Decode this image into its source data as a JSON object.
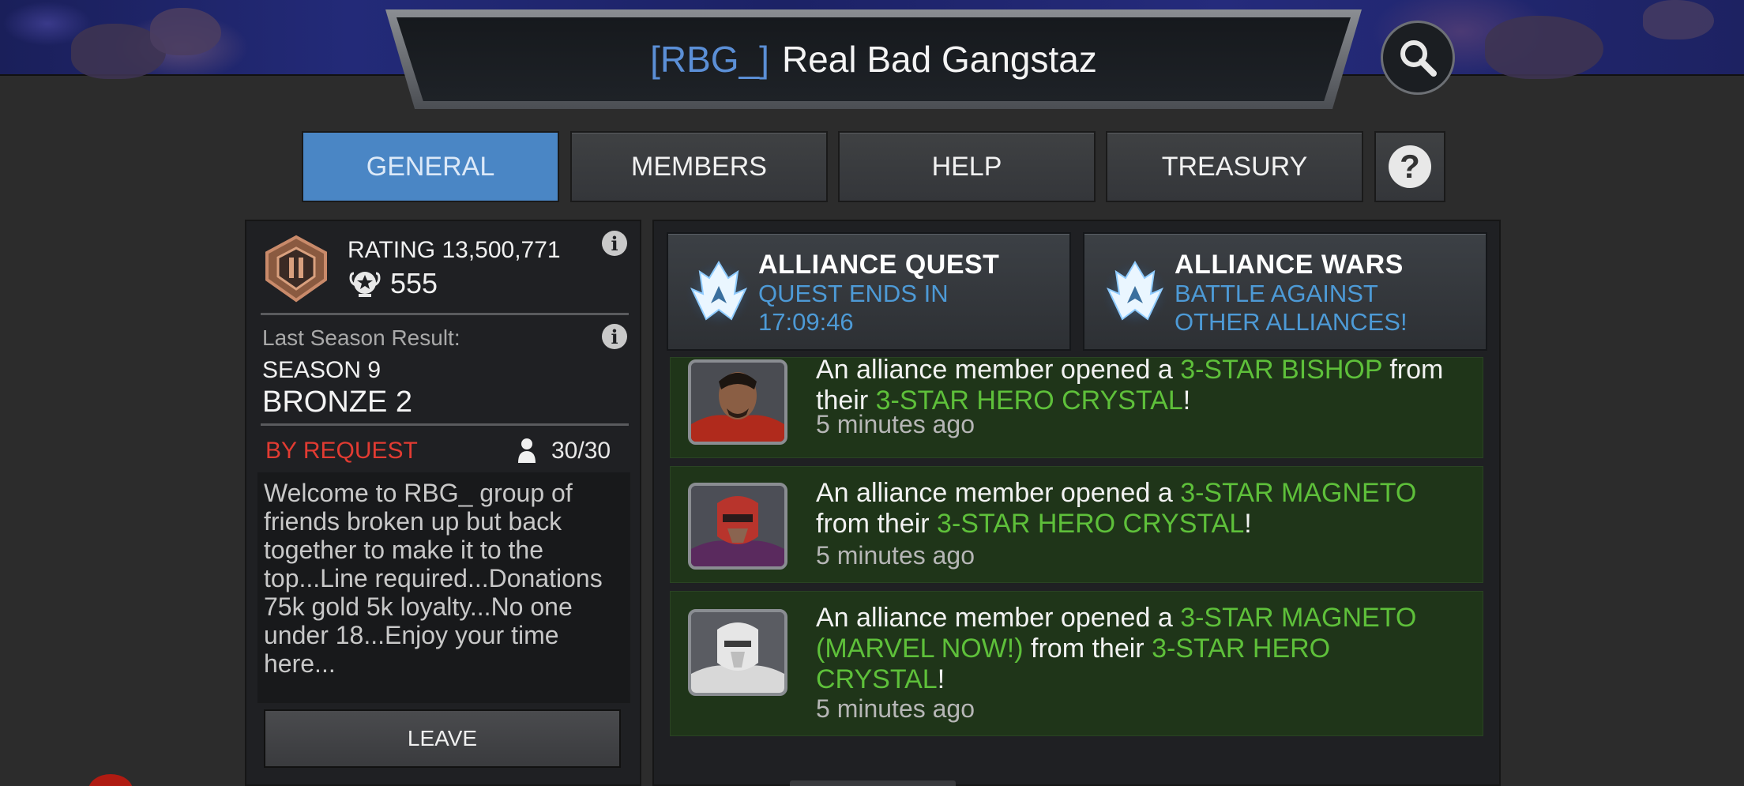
{
  "alliance": {
    "tag": "[RBG_]",
    "name": "Real Bad Gangstaz"
  },
  "tabs": [
    {
      "label": "GENERAL",
      "active": true
    },
    {
      "label": "MEMBERS",
      "active": false
    },
    {
      "label": "HELP",
      "active": false
    },
    {
      "label": "TREASURY",
      "active": false
    }
  ],
  "stats": {
    "rating_text": "RATING 13,500,771",
    "trophies": "555",
    "last_season_label": "Last Season Result:",
    "season": "SEASON 9",
    "tier": "BRONZE 2",
    "join_type": "BY REQUEST",
    "members": "30/30"
  },
  "description": "Welcome to RBG_ group of friends broken up but back together to make it to the top...Line required...Donations 75k gold 5k loyalty...No one under 18...Enjoy your time here...",
  "leave_label": "LEAVE",
  "events": [
    {
      "title": "ALLIANCE QUEST",
      "subtitle_1": "QUEST ENDS IN",
      "subtitle_2": "17:09:46"
    },
    {
      "title": "ALLIANCE WARS",
      "subtitle_1": "BATTLE AGAINST",
      "subtitle_2": "OTHER ALLIANCES!"
    }
  ],
  "feed": [
    {
      "prefix": "An alliance member opened a ",
      "champion": "3-STAR BISHOP",
      "middle": " from their ",
      "crystal": "3-STAR HERO CRYSTAL",
      "suffix": "!",
      "time": "5 minutes ago"
    },
    {
      "prefix": "An alliance member opened a ",
      "champion": "3-STAR MAGNETO",
      "middle": " from their ",
      "crystal": "3-STAR HERO CRYSTAL",
      "suffix": "!",
      "time": "5 minutes ago"
    },
    {
      "prefix": "An alliance member opened a ",
      "champion": "3-STAR MAGNETO (MARVEL NOW!)",
      "middle": " from their ",
      "crystal": "3-STAR HERO CRYSTAL",
      "suffix": "!",
      "time": "5 minutes ago"
    }
  ],
  "colors": {
    "accent_blue": "#4a86c5",
    "highlight_green": "#5ec03a",
    "request_red": "#e23b32",
    "feed_bg": "#1f3519"
  },
  "icons": {
    "search": "search-icon",
    "help": "question-icon",
    "info": "info-icon",
    "alliance_badge": "alliance-rank-badge-icon",
    "trophy": "trophy-star-icon",
    "member": "person-icon",
    "event": "alliance-flame-icon"
  }
}
